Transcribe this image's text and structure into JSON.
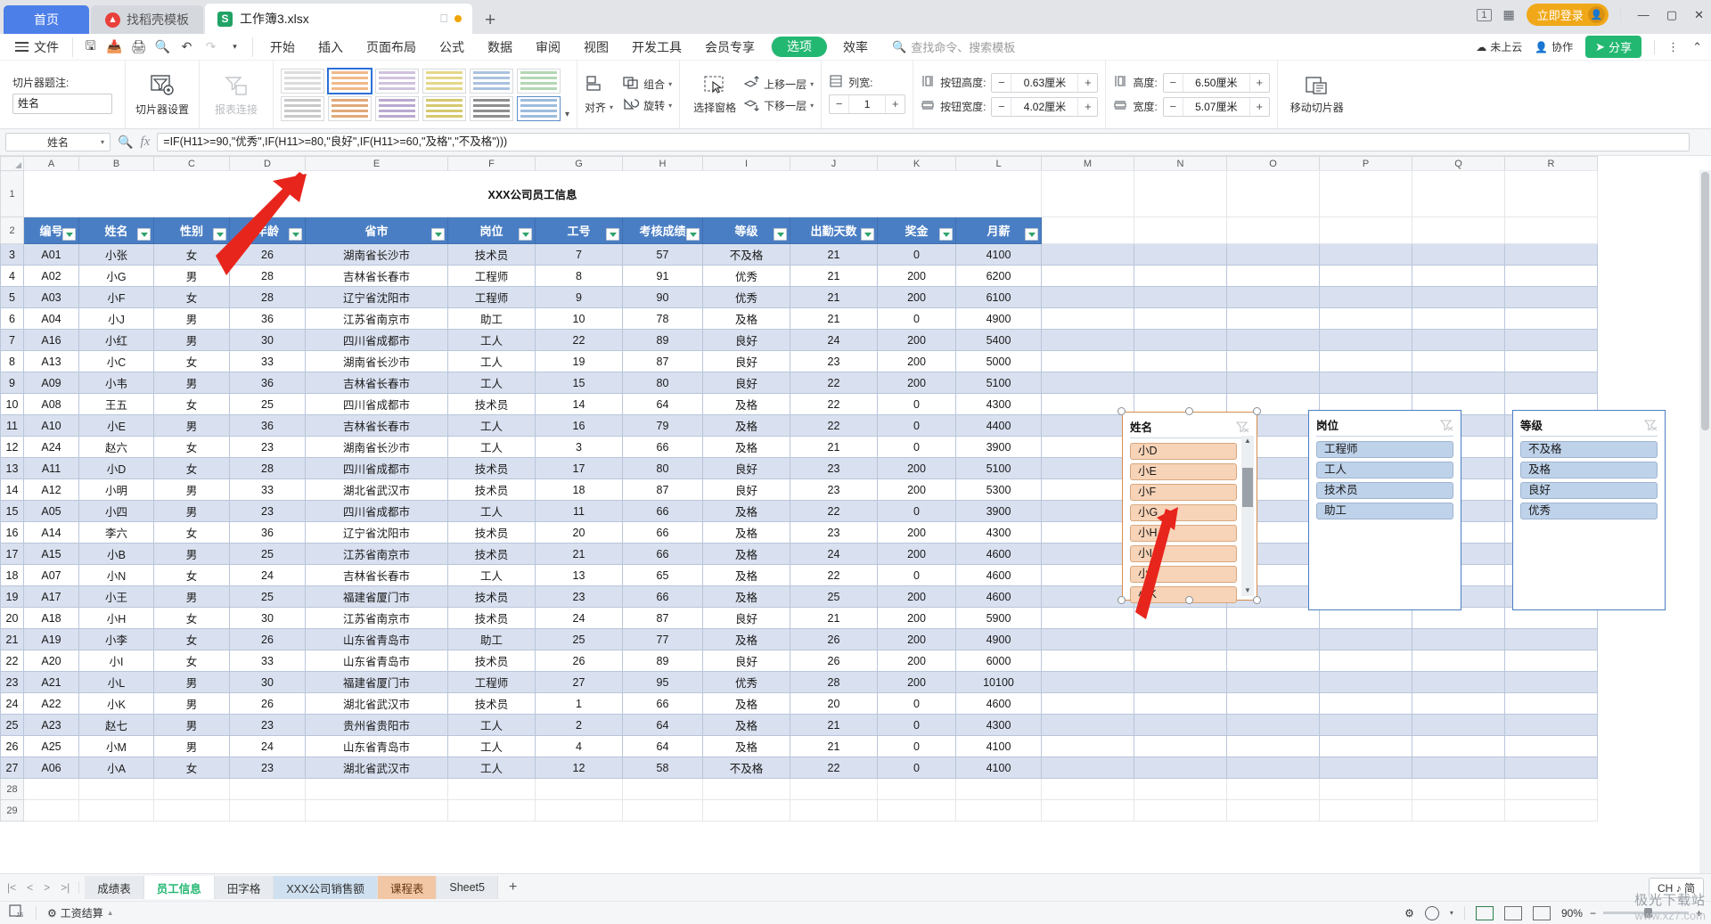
{
  "window": {
    "tabs": [
      {
        "label": "首页",
        "kind": "home"
      },
      {
        "label": "找稻壳模板",
        "kind": "template"
      },
      {
        "label": "工作簿3.xlsx",
        "kind": "doc",
        "active": true
      }
    ],
    "new_tab": "+",
    "page_num": "1",
    "login_label": "立即登录",
    "minimize": "—",
    "maximize": "▢",
    "close": "✕"
  },
  "menubar": {
    "file_label": "文件",
    "quick_icons": [
      "save-icon",
      "save-as-icon",
      "print-icon",
      "print-preview-icon",
      "undo-icon",
      "redo-icon",
      "more-icon"
    ],
    "tabs": [
      {
        "label": "开始"
      },
      {
        "label": "插入"
      },
      {
        "label": "页面布局"
      },
      {
        "label": "公式"
      },
      {
        "label": "数据"
      },
      {
        "label": "审阅"
      },
      {
        "label": "视图"
      },
      {
        "label": "开发工具"
      },
      {
        "label": "会员专享"
      }
    ],
    "pill_tab": "选项",
    "after_pill_tab": "效率",
    "search_placeholder": "查找命令、搜索模板",
    "cloud_status": "未上云",
    "collab": "协作",
    "share": "分享"
  },
  "ribbon": {
    "caption_label": "切片器题注:",
    "caption_value": "姓名",
    "slicer_settings": "切片器设置",
    "report_connect": "报表连接",
    "align": "对齐",
    "group": "组合",
    "rotate": "旋转",
    "select_pane": "选择窗格",
    "bring_forward": "上移一层",
    "send_backward": "下移一层",
    "columns_label": "列宽:",
    "columns_value": "1",
    "btn_height_label": "按钮高度:",
    "btn_height_value": "0.63厘米",
    "btn_width_label": "按钮宽度:",
    "btn_width_value": "4.02厘米",
    "height_label": "高度:",
    "height_value": "6.50厘米",
    "width_label": "宽度:",
    "width_value": "5.07厘米",
    "move_slicer": "移动切片器",
    "minus": "−",
    "plus": "+"
  },
  "formulabar": {
    "namebox": "姓名",
    "formula": "=IF(H11>=90,\"优秀\",IF(H11>=80,\"良好\",IF(H11>=60,\"及格\",\"不及格\")))",
    "fx": "fx"
  },
  "grid": {
    "columns": [
      "A",
      "B",
      "C",
      "D",
      "E",
      "F",
      "G",
      "H",
      "I",
      "J",
      "K",
      "L",
      "M",
      "N",
      "O",
      "P",
      "Q",
      "R"
    ],
    "rows": [
      "1",
      "2",
      "3",
      "4",
      "5",
      "6",
      "7",
      "8",
      "9",
      "10",
      "11",
      "12",
      "13",
      "14",
      "15",
      "16",
      "17",
      "18",
      "19",
      "20",
      "21",
      "22",
      "23",
      "24",
      "25",
      "26",
      "27",
      "28",
      "29"
    ],
    "sheet_title": "XXX公司员工信息"
  },
  "table": {
    "headers": [
      "编号",
      "姓名",
      "性别",
      "年龄",
      "省市",
      "岗位",
      "工号",
      "考核成绩",
      "等级",
      "出勤天数",
      "奖金",
      "月薪"
    ],
    "rows": [
      [
        "A01",
        "小张",
        "女",
        "26",
        "湖南省长沙市",
        "技术员",
        "7",
        "57",
        "不及格",
        "21",
        "0",
        "4100"
      ],
      [
        "A02",
        "小G",
        "男",
        "28",
        "吉林省长春市",
        "工程师",
        "8",
        "91",
        "优秀",
        "21",
        "200",
        "6200"
      ],
      [
        "A03",
        "小F",
        "女",
        "28",
        "辽宁省沈阳市",
        "工程师",
        "9",
        "90",
        "优秀",
        "21",
        "200",
        "6100"
      ],
      [
        "A04",
        "小J",
        "男",
        "36",
        "江苏省南京市",
        "助工",
        "10",
        "78",
        "及格",
        "21",
        "0",
        "4900"
      ],
      [
        "A16",
        "小红",
        "男",
        "30",
        "四川省成都市",
        "工人",
        "22",
        "89",
        "良好",
        "24",
        "200",
        "5400"
      ],
      [
        "A13",
        "小C",
        "女",
        "33",
        "湖南省长沙市",
        "工人",
        "19",
        "87",
        "良好",
        "23",
        "200",
        "5000"
      ],
      [
        "A09",
        "小韦",
        "男",
        "36",
        "吉林省长春市",
        "工人",
        "15",
        "80",
        "良好",
        "22",
        "200",
        "5100"
      ],
      [
        "A08",
        "王五",
        "女",
        "25",
        "四川省成都市",
        "技术员",
        "14",
        "64",
        "及格",
        "22",
        "0",
        "4300"
      ],
      [
        "A10",
        "小E",
        "男",
        "36",
        "吉林省长春市",
        "工人",
        "16",
        "79",
        "及格",
        "22",
        "0",
        "4400"
      ],
      [
        "A24",
        "赵六",
        "女",
        "23",
        "湖南省长沙市",
        "工人",
        "3",
        "66",
        "及格",
        "21",
        "0",
        "3900"
      ],
      [
        "A11",
        "小D",
        "女",
        "28",
        "四川省成都市",
        "技术员",
        "17",
        "80",
        "良好",
        "23",
        "200",
        "5100"
      ],
      [
        "A12",
        "小明",
        "男",
        "33",
        "湖北省武汉市",
        "技术员",
        "18",
        "87",
        "良好",
        "23",
        "200",
        "5300"
      ],
      [
        "A05",
        "小四",
        "男",
        "23",
        "四川省成都市",
        "工人",
        "11",
        "66",
        "及格",
        "22",
        "0",
        "3900"
      ],
      [
        "A14",
        "李六",
        "女",
        "36",
        "辽宁省沈阳市",
        "技术员",
        "20",
        "66",
        "及格",
        "23",
        "200",
        "4300"
      ],
      [
        "A15",
        "小B",
        "男",
        "25",
        "江苏省南京市",
        "技术员",
        "21",
        "66",
        "及格",
        "24",
        "200",
        "4600"
      ],
      [
        "A07",
        "小N",
        "女",
        "24",
        "吉林省长春市",
        "工人",
        "13",
        "65",
        "及格",
        "22",
        "0",
        "4600"
      ],
      [
        "A17",
        "小王",
        "男",
        "25",
        "福建省厦门市",
        "技术员",
        "23",
        "66",
        "及格",
        "25",
        "200",
        "4600"
      ],
      [
        "A18",
        "小H",
        "女",
        "30",
        "江苏省南京市",
        "技术员",
        "24",
        "87",
        "良好",
        "21",
        "200",
        "5900"
      ],
      [
        "A19",
        "小李",
        "女",
        "26",
        "山东省青岛市",
        "助工",
        "25",
        "77",
        "及格",
        "26",
        "200",
        "4900"
      ],
      [
        "A20",
        "小I",
        "女",
        "33",
        "山东省青岛市",
        "技术员",
        "26",
        "89",
        "良好",
        "26",
        "200",
        "6000"
      ],
      [
        "A21",
        "小L",
        "男",
        "30",
        "福建省厦门市",
        "工程师",
        "27",
        "95",
        "优秀",
        "28",
        "200",
        "10100"
      ],
      [
        "A22",
        "小K",
        "男",
        "26",
        "湖北省武汉市",
        "技术员",
        "1",
        "66",
        "及格",
        "20",
        "0",
        "4600"
      ],
      [
        "A23",
        "赵七",
        "男",
        "23",
        "贵州省贵阳市",
        "工人",
        "2",
        "64",
        "及格",
        "21",
        "0",
        "4300"
      ],
      [
        "A25",
        "小M",
        "男",
        "24",
        "山东省青岛市",
        "工人",
        "4",
        "64",
        "及格",
        "21",
        "0",
        "4100"
      ],
      [
        "A06",
        "小A",
        "女",
        "23",
        "湖北省武汉市",
        "工人",
        "12",
        "58",
        "不及格",
        "22",
        "0",
        "4100"
      ]
    ]
  },
  "slicers": [
    {
      "title": "姓名",
      "items": [
        "小D",
        "小E",
        "小F",
        "小G",
        "小H",
        "小I",
        "小J",
        "小K"
      ],
      "style": "orange",
      "selected": true,
      "scrollbar": true,
      "filter_icon": "clear-filter-icon"
    },
    {
      "title": "岗位",
      "items": [
        "工程师",
        "工人",
        "技术员",
        "助工"
      ],
      "style": "blue",
      "selected": false,
      "scrollbar": false,
      "filter_icon": "clear-filter-icon"
    },
    {
      "title": "等级",
      "items": [
        "不及格",
        "及格",
        "良好",
        "优秀"
      ],
      "style": "blue",
      "selected": false,
      "scrollbar": false,
      "filter_icon": "clear-filter-icon"
    }
  ],
  "sheettabs": {
    "nav": [
      "|<",
      "<",
      ">",
      ">|"
    ],
    "items": [
      {
        "label": "成绩表",
        "color": "plain"
      },
      {
        "label": "员工信息",
        "color": "active"
      },
      {
        "label": "田字格",
        "color": "plain"
      },
      {
        "label": "XXX公司销售额",
        "color": "blue"
      },
      {
        "label": "课程表",
        "color": "orange"
      },
      {
        "label": "Sheet5",
        "color": "plain"
      }
    ],
    "add": "+",
    "ime": "CH ♪ 简"
  },
  "statusbar": {
    "macro_label": "工资结算",
    "zoom": "90%",
    "zoom_minus": "−",
    "zoom_plus": "+",
    "watermark_line1": "极光下载站",
    "watermark_line2": "www.xz7.com"
  },
  "colors": {
    "accent_green": "#23b872",
    "header_blue": "#4a7ec4",
    "slicer_orange": "#f7d3b8",
    "slicer_blue": "#bed2ea",
    "login_amber": "#f0a818",
    "arrow_red": "#e8251c"
  }
}
